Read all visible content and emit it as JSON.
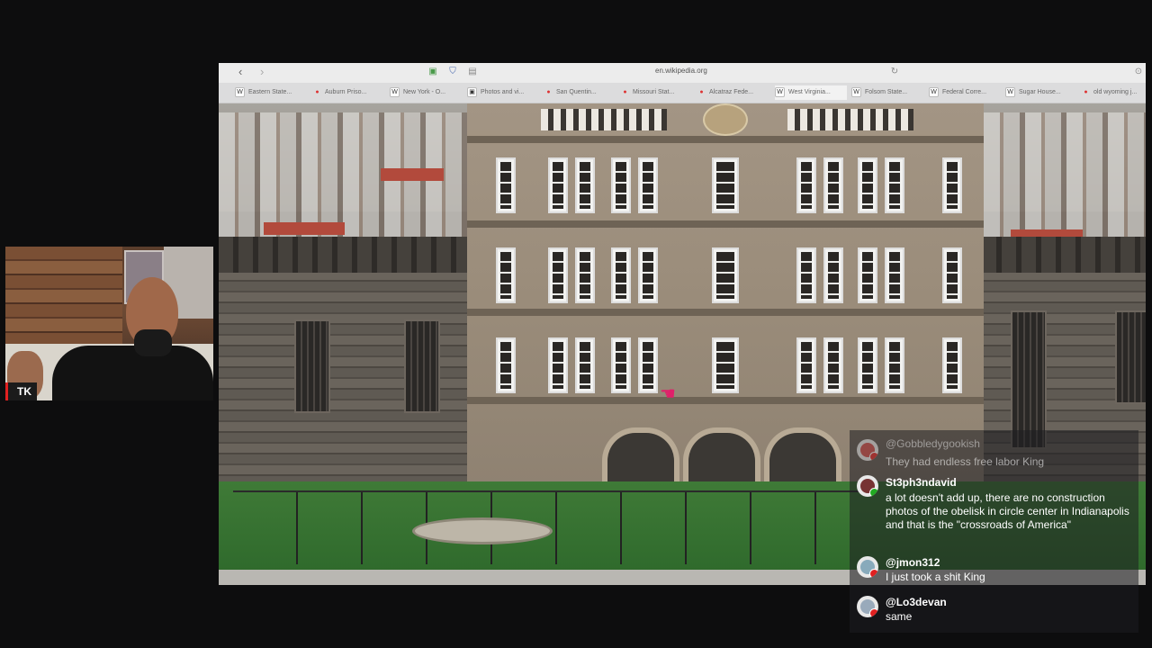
{
  "webcam": {
    "name_tag": "TK"
  },
  "browser": {
    "url": "en.wikipedia.org",
    "tabs": [
      {
        "label": "Eastern State...",
        "icon": "W"
      },
      {
        "label": "Auburn Priso...",
        "icon": "●"
      },
      {
        "label": "New York - O...",
        "icon": "W"
      },
      {
        "label": "Photos and vi...",
        "icon": "▣"
      },
      {
        "label": "San Quentin...",
        "icon": "●"
      },
      {
        "label": "Missouri Stat...",
        "icon": "●"
      },
      {
        "label": "Alcatraz Fede...",
        "icon": "●"
      },
      {
        "label": "West Virginia...",
        "icon": "W"
      },
      {
        "label": "Folsom State...",
        "icon": "W"
      },
      {
        "label": "Federal Corre...",
        "icon": "W"
      },
      {
        "label": "Sugar House...",
        "icon": "W"
      },
      {
        "label": "old wyoming j...",
        "icon": "●"
      }
    ]
  },
  "chat": [
    {
      "user": "@Gobbledygookish",
      "text": "They had endless free labor King"
    },
    {
      "user": "St3ph3ndavid",
      "text": "a lot doesn't add up, there are no construction photos of the obelisk in circle center in Indianapolis and that is the \"crossroads of America\""
    },
    {
      "user": "@jmon312",
      "text": "I just took a shit King"
    },
    {
      "user": "@Lo3devan",
      "text": "same"
    }
  ]
}
